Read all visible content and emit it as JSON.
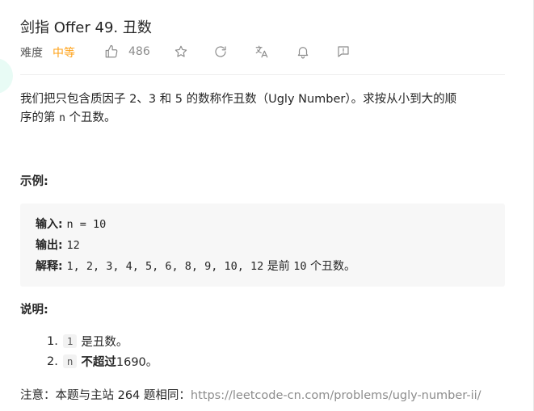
{
  "question": {
    "title": "剑指 Offer 49. 丑数",
    "difficulty_label": "难度",
    "difficulty_value": "中等",
    "likes": "486",
    "difficulty_color": "#ffa116"
  },
  "toolbar_icons": [
    "thumbs-up-icon",
    "star-icon",
    "refresh-icon",
    "translate-icon",
    "bell-icon",
    "feedback-icon"
  ],
  "description": {
    "line1": "我们把只包含质因子 2、3 和 5 的数称作丑数（Ugly Number）。求按从小到大的顺",
    "line2_pre": "序的第 ",
    "line2_code": "n",
    "line2_post": " 个丑数。"
  },
  "example": {
    "heading": "示例:",
    "input_label": "输入: ",
    "input_value": "n = 10",
    "output_label": "输出: ",
    "output_value": "12",
    "explain_label": "解释: ",
    "explain_value": "1, 2, 3, 4, 5, 6, 8, 9, 10, 12",
    "explain_mid": " 是前 ",
    "explain_num": "10",
    "explain_tail": " 个丑数。"
  },
  "notes": {
    "heading": "说明:",
    "items": [
      {
        "num": "1.",
        "code": "1",
        "bold": "",
        "text": "是丑数。"
      },
      {
        "num": "2.",
        "code": "n",
        "bold": "不超过",
        "text": "1690。"
      }
    ]
  },
  "footer": {
    "text": "注意：本题与主站 264 题相同：",
    "link": "https://leetcode-cn.com/problems/ugly-number-ii/"
  }
}
